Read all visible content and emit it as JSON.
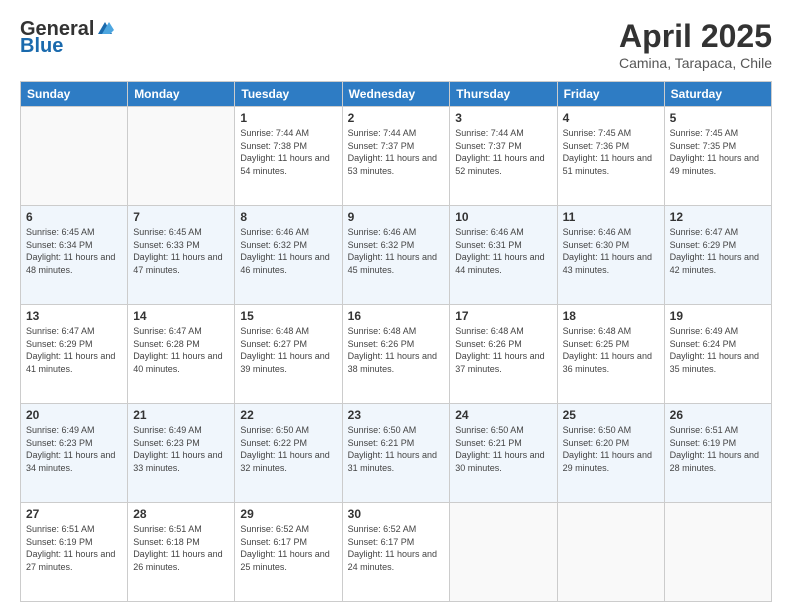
{
  "logo": {
    "general": "General",
    "blue": "Blue"
  },
  "header": {
    "month_year": "April 2025",
    "location": "Camina, Tarapaca, Chile"
  },
  "days_of_week": [
    "Sunday",
    "Monday",
    "Tuesday",
    "Wednesday",
    "Thursday",
    "Friday",
    "Saturday"
  ],
  "weeks": [
    [
      {
        "day": "",
        "info": ""
      },
      {
        "day": "",
        "info": ""
      },
      {
        "day": "1",
        "info": "Sunrise: 7:44 AM\nSunset: 7:38 PM\nDaylight: 11 hours and 54 minutes."
      },
      {
        "day": "2",
        "info": "Sunrise: 7:44 AM\nSunset: 7:37 PM\nDaylight: 11 hours and 53 minutes."
      },
      {
        "day": "3",
        "info": "Sunrise: 7:44 AM\nSunset: 7:37 PM\nDaylight: 11 hours and 52 minutes."
      },
      {
        "day": "4",
        "info": "Sunrise: 7:45 AM\nSunset: 7:36 PM\nDaylight: 11 hours and 51 minutes."
      },
      {
        "day": "5",
        "info": "Sunrise: 7:45 AM\nSunset: 7:35 PM\nDaylight: 11 hours and 49 minutes."
      }
    ],
    [
      {
        "day": "6",
        "info": "Sunrise: 6:45 AM\nSunset: 6:34 PM\nDaylight: 11 hours and 48 minutes."
      },
      {
        "day": "7",
        "info": "Sunrise: 6:45 AM\nSunset: 6:33 PM\nDaylight: 11 hours and 47 minutes."
      },
      {
        "day": "8",
        "info": "Sunrise: 6:46 AM\nSunset: 6:32 PM\nDaylight: 11 hours and 46 minutes."
      },
      {
        "day": "9",
        "info": "Sunrise: 6:46 AM\nSunset: 6:32 PM\nDaylight: 11 hours and 45 minutes."
      },
      {
        "day": "10",
        "info": "Sunrise: 6:46 AM\nSunset: 6:31 PM\nDaylight: 11 hours and 44 minutes."
      },
      {
        "day": "11",
        "info": "Sunrise: 6:46 AM\nSunset: 6:30 PM\nDaylight: 11 hours and 43 minutes."
      },
      {
        "day": "12",
        "info": "Sunrise: 6:47 AM\nSunset: 6:29 PM\nDaylight: 11 hours and 42 minutes."
      }
    ],
    [
      {
        "day": "13",
        "info": "Sunrise: 6:47 AM\nSunset: 6:29 PM\nDaylight: 11 hours and 41 minutes."
      },
      {
        "day": "14",
        "info": "Sunrise: 6:47 AM\nSunset: 6:28 PM\nDaylight: 11 hours and 40 minutes."
      },
      {
        "day": "15",
        "info": "Sunrise: 6:48 AM\nSunset: 6:27 PM\nDaylight: 11 hours and 39 minutes."
      },
      {
        "day": "16",
        "info": "Sunrise: 6:48 AM\nSunset: 6:26 PM\nDaylight: 11 hours and 38 minutes."
      },
      {
        "day": "17",
        "info": "Sunrise: 6:48 AM\nSunset: 6:26 PM\nDaylight: 11 hours and 37 minutes."
      },
      {
        "day": "18",
        "info": "Sunrise: 6:48 AM\nSunset: 6:25 PM\nDaylight: 11 hours and 36 minutes."
      },
      {
        "day": "19",
        "info": "Sunrise: 6:49 AM\nSunset: 6:24 PM\nDaylight: 11 hours and 35 minutes."
      }
    ],
    [
      {
        "day": "20",
        "info": "Sunrise: 6:49 AM\nSunset: 6:23 PM\nDaylight: 11 hours and 34 minutes."
      },
      {
        "day": "21",
        "info": "Sunrise: 6:49 AM\nSunset: 6:23 PM\nDaylight: 11 hours and 33 minutes."
      },
      {
        "day": "22",
        "info": "Sunrise: 6:50 AM\nSunset: 6:22 PM\nDaylight: 11 hours and 32 minutes."
      },
      {
        "day": "23",
        "info": "Sunrise: 6:50 AM\nSunset: 6:21 PM\nDaylight: 11 hours and 31 minutes."
      },
      {
        "day": "24",
        "info": "Sunrise: 6:50 AM\nSunset: 6:21 PM\nDaylight: 11 hours and 30 minutes."
      },
      {
        "day": "25",
        "info": "Sunrise: 6:50 AM\nSunset: 6:20 PM\nDaylight: 11 hours and 29 minutes."
      },
      {
        "day": "26",
        "info": "Sunrise: 6:51 AM\nSunset: 6:19 PM\nDaylight: 11 hours and 28 minutes."
      }
    ],
    [
      {
        "day": "27",
        "info": "Sunrise: 6:51 AM\nSunset: 6:19 PM\nDaylight: 11 hours and 27 minutes."
      },
      {
        "day": "28",
        "info": "Sunrise: 6:51 AM\nSunset: 6:18 PM\nDaylight: 11 hours and 26 minutes."
      },
      {
        "day": "29",
        "info": "Sunrise: 6:52 AM\nSunset: 6:17 PM\nDaylight: 11 hours and 25 minutes."
      },
      {
        "day": "30",
        "info": "Sunrise: 6:52 AM\nSunset: 6:17 PM\nDaylight: 11 hours and 24 minutes."
      },
      {
        "day": "",
        "info": ""
      },
      {
        "day": "",
        "info": ""
      },
      {
        "day": "",
        "info": ""
      }
    ]
  ]
}
